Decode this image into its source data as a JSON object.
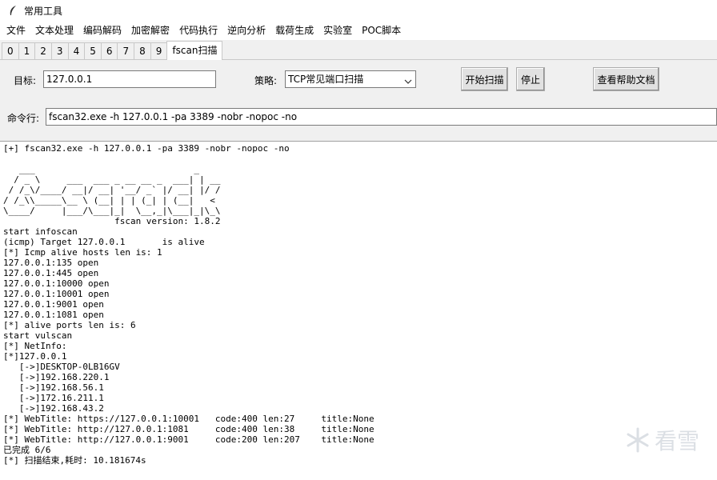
{
  "window": {
    "title": "常用工具"
  },
  "menu": [
    "文件",
    "文本处理",
    "编码解码",
    "加密解密",
    "代码执行",
    "逆向分析",
    "载荷生成",
    "实验室",
    "POC脚本"
  ],
  "tabs": [
    "0",
    "1",
    "2",
    "3",
    "4",
    "5",
    "6",
    "7",
    "8",
    "9",
    "fscan扫描"
  ],
  "active_tab": "fscan扫描",
  "form": {
    "target_label": "目标:",
    "target_value": "127.0.0.1",
    "strategy_label": "策略:",
    "strategy_value": "TCP常见端口扫描",
    "start_button": "开始扫描",
    "stop_button": "停止",
    "help_button": "查看帮助文档",
    "command_label": "命令行:",
    "command_value": "fscan32.exe -h 127.0.0.1 -pa 3389 -nobr -nopoc -no"
  },
  "output": {
    "lines": [
      "[+] fscan32.exe -h 127.0.0.1 -pa 3389 -nobr -nopoc -no",
      "",
      "   ___                              _",
      "  / _ \\     ___  ___ _ __ __ _  ___| | __",
      " / /_\\/____/ __|/ __| '__/ _` |/ __| |/ /",
      "/ /_\\\\_____\\__ \\ (__| | | (_| | (__|   <",
      "\\____/     |___/\\___|_|  \\__,_|\\___|_|\\_\\",
      "                     fscan version: 1.8.2",
      "start infoscan",
      "(icmp) Target 127.0.0.1       is alive",
      "[*] Icmp alive hosts len is: 1",
      "127.0.0.1:135 open",
      "127.0.0.1:445 open",
      "127.0.0.1:10000 open",
      "127.0.0.1:10001 open",
      "127.0.0.1:9001 open",
      "127.0.0.1:1081 open",
      "[*] alive ports len is: 6",
      "start vulscan",
      "[*] NetInfo:",
      "[*]127.0.0.1",
      "   [->]DESKTOP-0LB16GV",
      "   [->]192.168.220.1",
      "   [->]192.168.56.1",
      "   [->]172.16.211.1",
      "   [->]192.168.43.2",
      "[*] WebTitle: https://127.0.0.1:10001   code:400 len:27     title:None",
      "[*] WebTitle: http://127.0.0.1:1081     code:400 len:38     title:None",
      "[*] WebTitle: http://127.0.0.1:9001     code:200 len:207    title:None",
      "已完成 6/6",
      "[*] 扫描结束,耗时: 10.181674s"
    ]
  },
  "watermark": "看雪"
}
